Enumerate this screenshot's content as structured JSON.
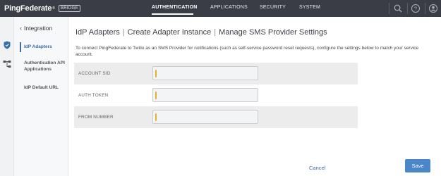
{
  "brand": {
    "name": "PingFederate",
    "reg": "®",
    "badge": "BRIDGE"
  },
  "nav": {
    "items": [
      "AUTHENTICATION",
      "APPLICATIONS",
      "SECURITY",
      "SYSTEM"
    ],
    "active": "AUTHENTICATION"
  },
  "top_icons": [
    "search-icon",
    "help-icon",
    "user-icon"
  ],
  "rail": {
    "icons": [
      "shield-icon",
      "sitemap-icon"
    ]
  },
  "subnav": {
    "back_label": "Integration",
    "items": [
      "IdP Adapters",
      "Authentication API Applications",
      "IdP Default URL"
    ],
    "active": "IdP Adapters"
  },
  "breadcrumb": [
    "IdP Adapters",
    "Create Adapter Instance",
    "Manage SMS Provider Settings"
  ],
  "description": "To connect PingFederate to Twilio as an SMS Provider for notifications (such as self-service password reset requests), configure the settings below to match your service account.",
  "fields": [
    {
      "label": "ACCOUNT SID",
      "value": "",
      "required": true
    },
    {
      "label": "AUTH TOKEN",
      "value": "",
      "required": true
    },
    {
      "label": "FROM NUMBER",
      "value": "",
      "required": true
    }
  ],
  "actions": {
    "cancel": "Cancel",
    "save": "Save"
  },
  "colors": {
    "topbar": "#3a3d46",
    "accent": "#4a86c8",
    "required": "#e2b02c",
    "link": "#3a6fa6"
  }
}
